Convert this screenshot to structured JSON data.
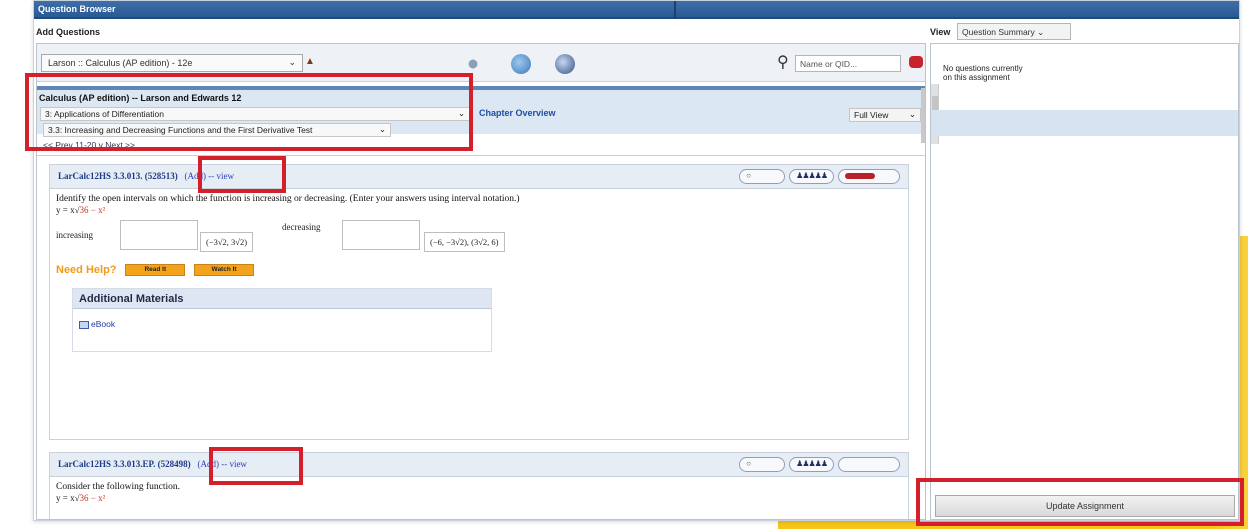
{
  "window": {
    "title": "Question Browser"
  },
  "header": {
    "add_questions": "Add Questions",
    "view_label": "View",
    "view_select": "Question Summary"
  },
  "toolbar": {
    "book_select": "Larson :: Calculus (AP edition) - 12e",
    "search_placeholder": "Name or QID..."
  },
  "book": {
    "title": "Calculus (AP edition) -- Larson and Edwards 12",
    "chapter": "3: Applications of Differentiation",
    "section": "3.3: Increasing and Decreasing Functions and the First Derivative Test",
    "chapter_overview": "Chapter Overview",
    "view_mode": "Full View"
  },
  "pager": {
    "text": "<< Prev   11-20   v   Next >>"
  },
  "questions": [
    {
      "id": "LarCalc12HS 3.3.013. (528513)",
      "actions": "(Add) -- view",
      "prompt": "Identify the open intervals on which the function is increasing or decreasing. (Enter your answers using interval notation.)",
      "equation_prefix": "y = x√",
      "equation_radicand": "36 − x²",
      "increasing_label": "increasing",
      "increasing_answer": "(−3√2, 3√2)",
      "decreasing_label": "decreasing",
      "decreasing_answer": "(−6, −3√2), (3√2, 6)",
      "need_help": "Need Help?",
      "read_it": "Read It",
      "watch_it": "Watch It",
      "additional_materials": "Additional Materials",
      "ebook": "eBook"
    },
    {
      "id": "LarCalc12HS 3.3.013.EP. (528498)",
      "actions": "(Add) -- view",
      "prompt": "Consider the following function.",
      "equation_prefix": "y = x√",
      "equation_radicand": "36 − x²"
    }
  ],
  "right_panel": {
    "empty_message": "No questions currently on this assignment",
    "update_button": "Update Assignment"
  },
  "colors": {
    "highlight": "#d4202a",
    "titlebar": "#2f5f98",
    "accent_yellow": "#f5c51a"
  }
}
